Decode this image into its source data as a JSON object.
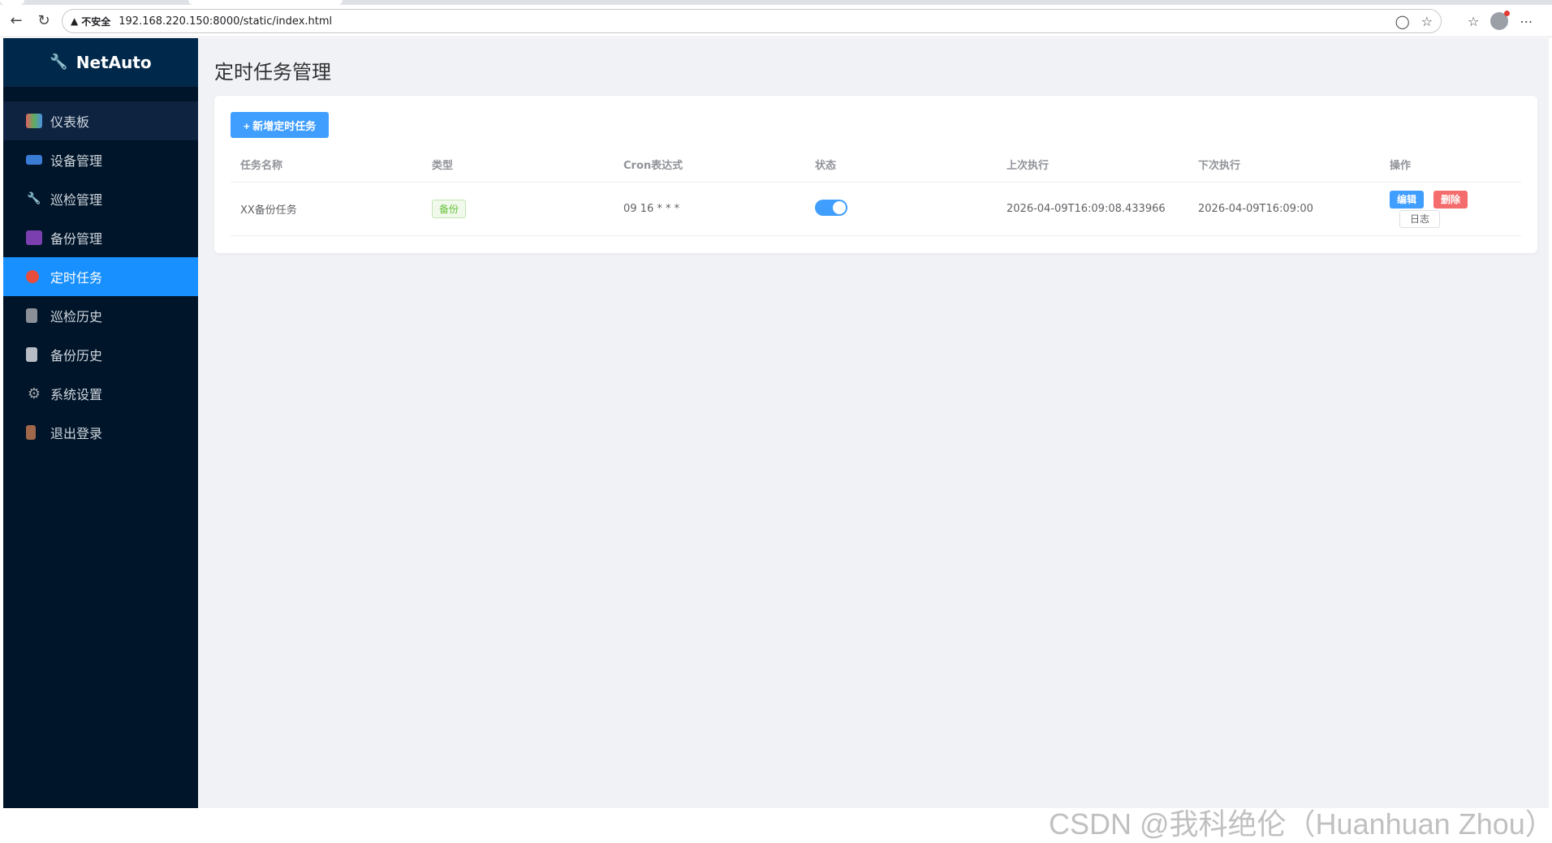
{
  "browser": {
    "security_label": "不安全",
    "url": "192.168.220.150:8000/static/index.html"
  },
  "sidebar": {
    "brand": "NetAuto",
    "brand_icon": "wrench-icon",
    "items": [
      {
        "label": "仪表板",
        "icon": "chart-icon",
        "state": "hover"
      },
      {
        "label": "设备管理",
        "icon": "monitor-icon",
        "state": ""
      },
      {
        "label": "巡检管理",
        "icon": "wrench-icon",
        "state": ""
      },
      {
        "label": "备份管理",
        "icon": "floppy-icon",
        "state": ""
      },
      {
        "label": "定时任务",
        "icon": "alarm-clock-icon",
        "state": "active"
      },
      {
        "label": "巡检历史",
        "icon": "notebook-icon",
        "state": ""
      },
      {
        "label": "备份历史",
        "icon": "document-icon",
        "state": ""
      },
      {
        "label": "系统设置",
        "icon": "gear-icon",
        "state": ""
      },
      {
        "label": "退出登录",
        "icon": "door-icon",
        "state": ""
      }
    ]
  },
  "main": {
    "title": "定时任务管理",
    "add_button": "+ 新增定时任务",
    "table": {
      "headers": [
        "任务名称",
        "类型",
        "Cron表达式",
        "状态",
        "上次执行",
        "下次执行",
        "操作"
      ],
      "rows": [
        {
          "name": "XX备份任务",
          "type": "备份",
          "cron": "09 16 * * *",
          "enabled": true,
          "last_run": "2026-04-09T16:09:08.433966",
          "next_run": "2026-04-09T16:09:00",
          "actions": {
            "edit": "编辑",
            "delete": "删除",
            "log": "日志"
          }
        }
      ]
    }
  },
  "watermark": "CSDN @我科绝伦（Huanhuan Zhou）",
  "colors": {
    "sidebar_bg": "#001529",
    "active": "#1890ff",
    "primary": "#409eff",
    "danger": "#f56c6c",
    "success": "#67c23a"
  }
}
